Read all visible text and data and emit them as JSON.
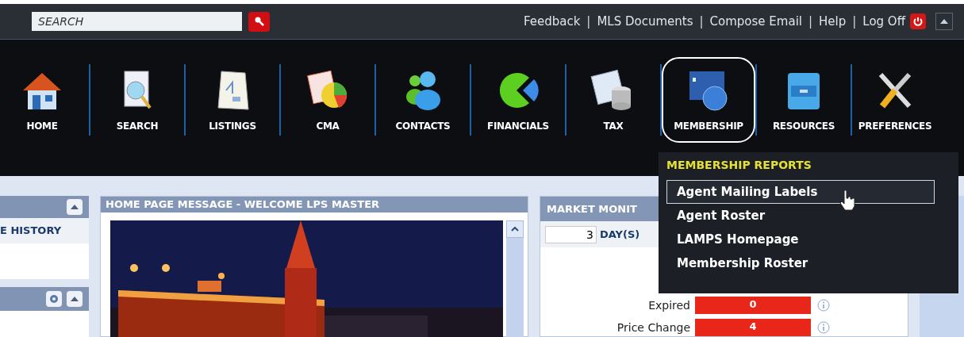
{
  "top_bar": {
    "search": {
      "placeholder": "SEARCH"
    },
    "links": [
      {
        "label": "Feedback"
      },
      {
        "label": "MLS Documents"
      },
      {
        "label": "Compose Email"
      },
      {
        "label": "Help"
      },
      {
        "label": "Log Off"
      }
    ],
    "separator": "|"
  },
  "nav": [
    {
      "label": "HOME",
      "selected": false
    },
    {
      "label": "SEARCH",
      "selected": false
    },
    {
      "label": "LISTINGS",
      "selected": false
    },
    {
      "label": "CMA",
      "selected": false
    },
    {
      "label": "CONTACTS",
      "selected": false
    },
    {
      "label": "FINANCIALS",
      "selected": false
    },
    {
      "label": "TAX",
      "selected": false
    },
    {
      "label": "MEMBERSHIP",
      "selected": true
    },
    {
      "label": "RESOURCES",
      "selected": false
    },
    {
      "label": "PREFERENCES",
      "selected": false
    }
  ],
  "dropdown": {
    "title": "MEMBERSHIP REPORTS",
    "items": [
      {
        "label": "Agent Mailing Labels",
        "selected": true
      },
      {
        "label": "Agent Roster",
        "selected": false
      },
      {
        "label": "LAMPS Homepage",
        "selected": false
      },
      {
        "label": "Membership Roster",
        "selected": false
      }
    ]
  },
  "left_panel": {
    "link": "E HISTORY"
  },
  "home_message": {
    "title": "HOME PAGE MESSAGE - WELCOME LPS MASTER"
  },
  "market_monitor": {
    "title": "MARKET MONIT",
    "days_value": "3",
    "days_label": "DAY(S)",
    "rows": [
      {
        "label": "Expired",
        "value": "0"
      },
      {
        "label": "Price Change",
        "value": "4"
      }
    ]
  }
}
